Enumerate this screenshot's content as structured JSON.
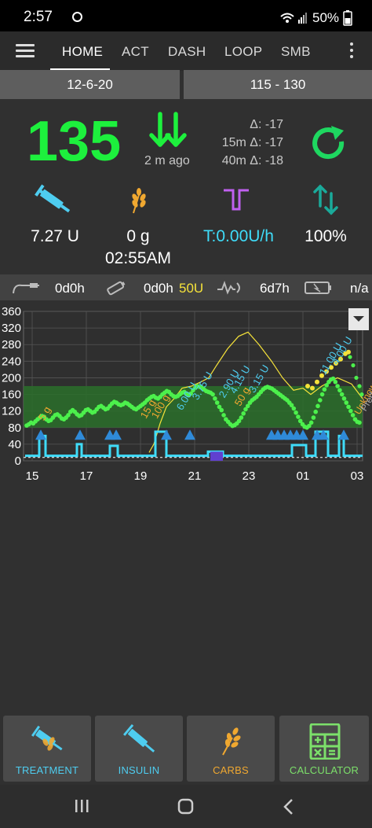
{
  "status_bar": {
    "time": "2:57",
    "battery": "50%"
  },
  "nav": {
    "tabs": [
      {
        "label": "HOME"
      },
      {
        "label": "ACT"
      },
      {
        "label": "DASH"
      },
      {
        "label": "LOOP"
      },
      {
        "label": "SMB"
      }
    ],
    "active_tab": "HOME"
  },
  "header": {
    "date": "12-6-20",
    "target_range": "115 - 130"
  },
  "bg": {
    "value": "135",
    "ago": "2 m ago",
    "delta": "Δ: -17",
    "delta_15m": "15m Δ: -17",
    "delta_40m": "40m Δ: -18",
    "color": "#1df03d"
  },
  "stats": {
    "iob": "7.27 U",
    "cob": "0 g",
    "cob_time": "02:55AM",
    "basal": "T:0.00U/h",
    "loop": "100%"
  },
  "pump_status": {
    "cannula_age": "0d0h",
    "reservoir_age": "0d0h",
    "reservoir_level": "50U",
    "sensor_age": "6d7h",
    "battery": "n/a"
  },
  "chart_data": {
    "type": "line",
    "y_ticks": [
      "0",
      "40",
      "80",
      "120",
      "160",
      "200",
      "240",
      "280",
      "320",
      "360"
    ],
    "x_ticks": [
      "15",
      "17",
      "19",
      "21",
      "23",
      "01",
      "03"
    ],
    "ylim": [
      0,
      360
    ],
    "target_low": 80,
    "target_high": 180,
    "series": [
      {
        "color": "#4cf04c",
        "x": [
          0,
          2,
          4,
          6,
          8,
          10,
          12,
          14,
          16,
          18,
          20,
          22,
          24,
          26,
          28,
          30,
          32,
          34,
          36,
          38,
          40,
          42,
          44,
          46,
          48,
          50,
          52,
          54,
          56,
          58,
          60,
          62,
          64,
          66,
          68,
          70,
          72,
          74,
          76,
          78,
          80,
          82,
          84,
          86,
          88,
          90,
          92,
          94,
          96,
          98,
          100,
          102,
          104,
          106,
          108,
          110,
          112,
          114,
          116,
          118,
          120,
          122,
          124,
          126,
          128,
          130,
          132,
          134,
          136,
          138,
          140,
          142,
          144,
          146,
          148,
          150,
          152,
          154,
          156,
          158,
          160,
          162,
          164,
          166,
          168,
          170,
          172,
          174,
          176,
          178,
          180,
          182,
          184,
          186,
          188,
          190,
          192,
          194,
          196,
          198,
          200,
          202,
          204,
          206,
          208,
          210,
          212,
          214,
          216,
          218,
          220,
          222,
          224,
          226,
          228,
          230,
          232,
          234,
          236,
          238,
          240,
          242,
          244,
          246,
          248,
          250,
          252,
          254,
          256,
          258,
          260,
          262,
          264,
          266,
          268,
          270,
          272,
          274,
          276,
          278,
          280,
          282,
          284,
          286,
          288,
          290,
          292,
          294,
          296,
          298,
          300,
          302,
          304
        ],
        "y": [
          85,
          88,
          92,
          90,
          95,
          100,
          104,
          108,
          106,
          100,
          96,
          98,
          104,
          110,
          112,
          108,
          102,
          100,
          104,
          110,
          118,
          122,
          118,
          112,
          108,
          110,
          116,
          122,
          124,
          120,
          116,
          118,
          124,
          130,
          132,
          128,
          124,
          126,
          132,
          138,
          142,
          140,
          136,
          134,
          136,
          140,
          138,
          134,
          130,
          126,
          124,
          128,
          132,
          136,
          140,
          146,
          150,
          154,
          156,
          152,
          150,
          154,
          160,
          164,
          168,
          166,
          160,
          156,
          154,
          156,
          160,
          164,
          166,
          162,
          158,
          162,
          170,
          176,
          180,
          178,
          176,
          172,
          168,
          166,
          164,
          160,
          150,
          140,
          130,
          122,
          110,
          100,
          94,
          88,
          84,
          86,
          90,
          96,
          104,
          114,
          124,
          132,
          140,
          146,
          150,
          154,
          160,
          166,
          172,
          176,
          178,
          176,
          174,
          170,
          166,
          162,
          158,
          154,
          150,
          146,
          140,
          134,
          126,
          116,
          106,
          96,
          88,
          82,
          80,
          84,
          92,
          104,
          118,
          132,
          146,
          160,
          172,
          182,
          190,
          196,
          198,
          190,
          180,
          170,
          160,
          150,
          140,
          130,
          120,
          110,
          100,
          94,
          92
        ]
      }
    ],
    "carb_labels": [
      "5 g",
      "15 g",
      "100 g",
      "50 g"
    ],
    "bolus_labels": [
      "6.00 U",
      "3.75 U",
      "2.90 U",
      "4.15 U",
      "3.15 U",
      "11.00 U",
      "4.00 U"
    ],
    "annotations": [
      "Unknown",
      "Pred"
    ]
  },
  "bottom_buttons": {
    "treatment": "TREATMENT",
    "insulin": "INSULIN",
    "carbs": "CARBS",
    "calculator": "CALCULATOR"
  },
  "colors": {
    "insulin": "#4ecdf0",
    "carbs": "#f0a830",
    "calculator": "#7ce06a",
    "basal": "#3fdcf9",
    "purple": "#c060f0"
  }
}
